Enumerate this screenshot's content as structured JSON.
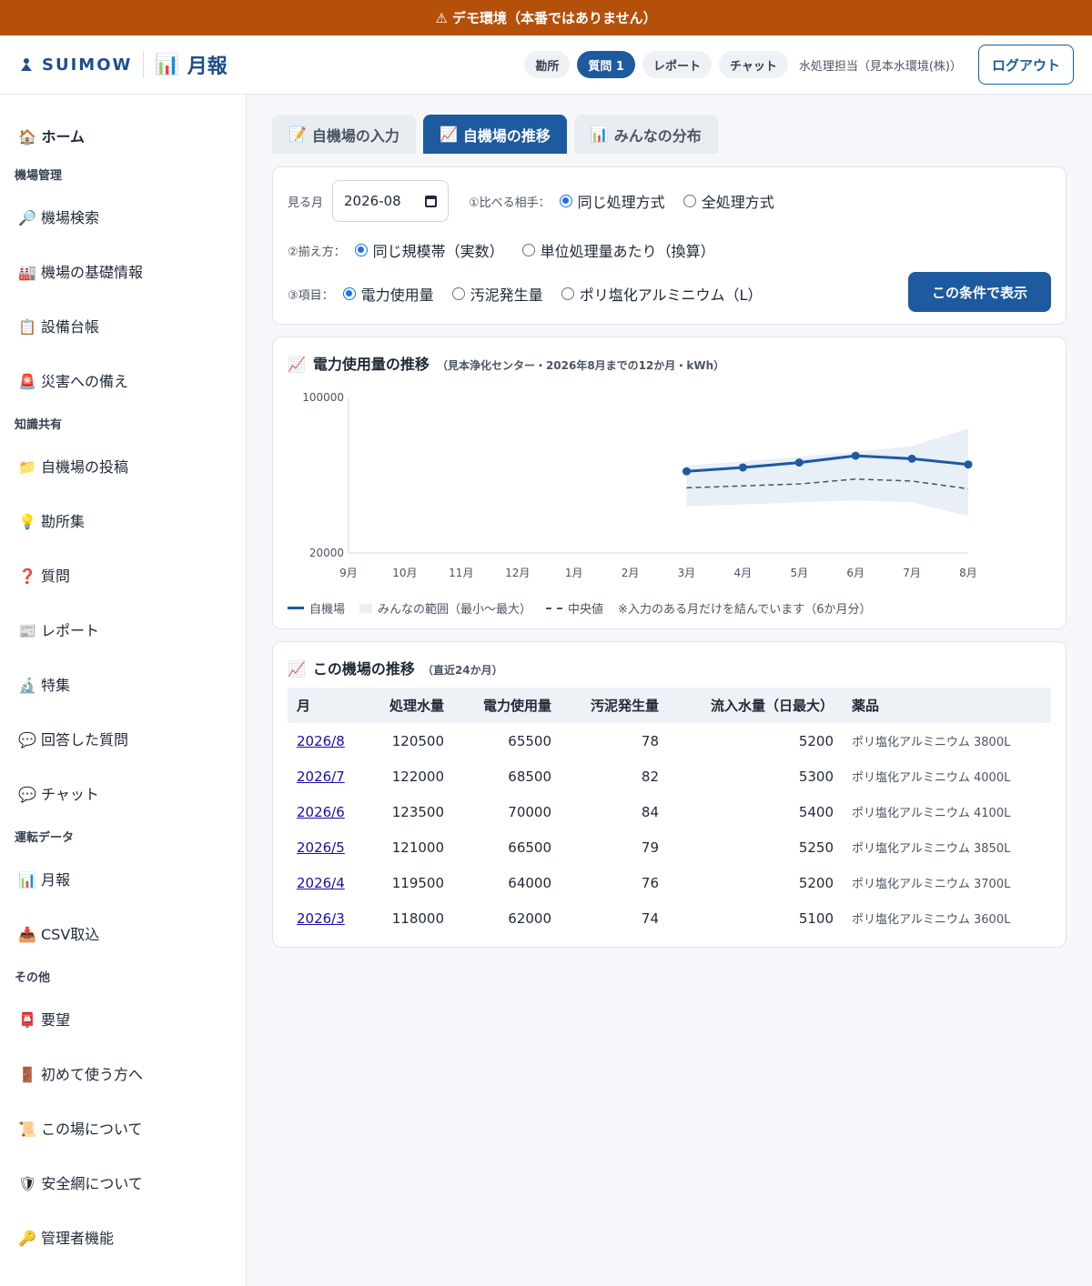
{
  "banner": {
    "text": "⚠ デモ環境（本番ではありません）"
  },
  "header": {
    "brand_icon": "water-drop-person",
    "brand": "SUIMOW",
    "page_icon": "📊",
    "page_title": "月報",
    "pills": [
      {
        "label": "勘所",
        "active": false
      },
      {
        "label": "質問 1",
        "active": true
      },
      {
        "label": "レポート",
        "active": false
      },
      {
        "label": "チャット",
        "active": false
      }
    ],
    "user": "水処理担当（見本水環境(株)）",
    "logout": "ログアウト"
  },
  "sidebar": {
    "home": "🏠 ホーム",
    "groups": [
      {
        "title": "機場管理",
        "items": [
          "🔎 機場検索",
          "🏭 機場の基礎情報",
          "📋 設備台帳",
          "🚨 災害への備え"
        ]
      },
      {
        "title": "知識共有",
        "items": [
          "📁 自機場の投稿",
          "💡 勘所集",
          "❓ 質問",
          "📰 レポート",
          "🔬 特集",
          "💬 回答した質問",
          "💬 チャット"
        ]
      },
      {
        "title": "運転データ",
        "items": [
          "📊 月報",
          "📥 CSV取込"
        ]
      },
      {
        "title": "その他",
        "items": [
          "📮 要望",
          "🚪 初めて使う方へ",
          "📜 この場について",
          "🛡 安全網について",
          "🔑 管理者機能"
        ]
      }
    ]
  },
  "tabs": [
    {
      "icon": "📝",
      "label": "自機場の入力",
      "active": false
    },
    {
      "icon": "📈",
      "label": "自機場の推移",
      "active": true
    },
    {
      "icon": "📊",
      "label": "みんなの分布",
      "active": false
    }
  ],
  "filters": {
    "month_label": "見る月",
    "month_value": "2026-08",
    "compare_label": "①比べる相手：",
    "compare_options": [
      {
        "label": "同じ処理方式",
        "checked": true
      },
      {
        "label": "全処理方式",
        "checked": false
      }
    ],
    "align_label": "②揃え方：",
    "align_options": [
      {
        "label": "同じ規模帯（実数）",
        "checked": true
      },
      {
        "label": "単位処理量あたり（換算）",
        "checked": false
      }
    ],
    "item_label": "③項目：",
    "item_options": [
      {
        "label": "電力使用量",
        "checked": true
      },
      {
        "label": "汚泥発生量",
        "checked": false
      },
      {
        "label": "ポリ塩化アルミニウム（L）",
        "checked": false
      }
    ],
    "submit": "この条件で表示"
  },
  "chart_card": {
    "icon": "📈",
    "title": "電力使用量の推移",
    "subtitle": "（見本浄化センター・2026年8月までの12か月・kWh）",
    "legend": {
      "own": "自機場",
      "range": "みんなの範囲（最小〜最大）",
      "median": "中央値",
      "note": "※入力のある月だけを結んでいます（6か月分）"
    }
  },
  "chart_data": {
    "type": "line",
    "x": [
      "9月",
      "10月",
      "11月",
      "12月",
      "1月",
      "2月",
      "3月",
      "4月",
      "5月",
      "6月",
      "7月",
      "8月"
    ],
    "ylim": [
      20000,
      100000
    ],
    "yticks": [
      20000,
      100000
    ],
    "series": [
      {
        "name": "自機場",
        "values": [
          null,
          null,
          null,
          null,
          null,
          null,
          62000,
          64000,
          66500,
          70000,
          68500,
          65500
        ],
        "color": "#1d5aa0"
      },
      {
        "name": "中央値",
        "values": [
          null,
          null,
          null,
          null,
          null,
          null,
          53500,
          54500,
          55500,
          58000,
          57000,
          53000
        ],
        "color": "#4b5563",
        "style": "dashed"
      }
    ],
    "range": {
      "name": "みんなの範囲（最小〜最大）",
      "min": [
        null,
        null,
        null,
        null,
        null,
        null,
        44000,
        45000,
        46000,
        47000,
        46000,
        39000
      ],
      "max": [
        null,
        null,
        null,
        null,
        null,
        null,
        65000,
        67000,
        69500,
        72000,
        75000,
        84000
      ],
      "color": "#e8eff7"
    }
  },
  "table_card": {
    "icon": "📈",
    "title": "この機場の推移",
    "subtitle": "（直近24か月）",
    "columns": [
      "月",
      "処理水量",
      "電力使用量",
      "汚泥発生量",
      "流入水量（日最大）",
      "薬品"
    ],
    "rows": [
      [
        "2026/8",
        "120500",
        "65500",
        "78",
        "5200",
        "ポリ塩化アルミニウム 3800L"
      ],
      [
        "2026/7",
        "122000",
        "68500",
        "82",
        "5300",
        "ポリ塩化アルミニウム 4000L"
      ],
      [
        "2026/6",
        "123500",
        "70000",
        "84",
        "5400",
        "ポリ塩化アルミニウム 4100L"
      ],
      [
        "2026/5",
        "121000",
        "66500",
        "79",
        "5250",
        "ポリ塩化アルミニウム 3850L"
      ],
      [
        "2026/4",
        "119500",
        "64000",
        "76",
        "5200",
        "ポリ塩化アルミニウム 3700L"
      ],
      [
        "2026/3",
        "118000",
        "62000",
        "74",
        "5100",
        "ポリ塩化アルミニウム 3600L"
      ]
    ]
  }
}
